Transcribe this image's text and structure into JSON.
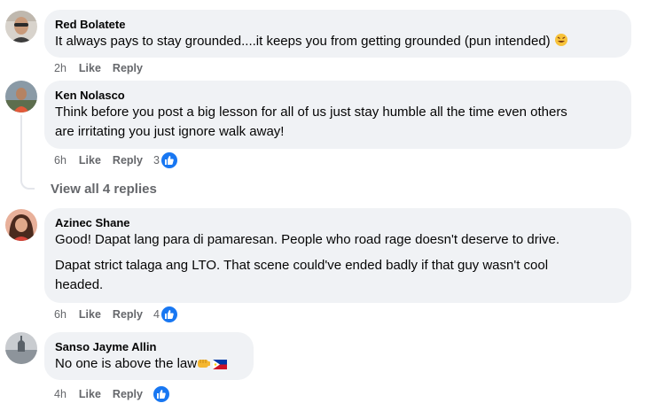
{
  "comments": [
    {
      "author": "Red Bolatete",
      "text": "It always pays to stay grounded....it keeps you from getting grounded (pun intended)",
      "time": "2h",
      "like": "Like",
      "reply": "Reply"
    },
    {
      "author": "Ken Nolasco",
      "text1": "Think before you post a big lesson for all of us just stay humble all the time even others",
      "text2": "are irritating you just ignore walk away!",
      "time": "6h",
      "like": "Like",
      "reply": "Reply",
      "reactions": "3",
      "view_replies": "View all 4 replies"
    },
    {
      "author": "Azinec Shane",
      "text1": "Good! Dapat lang para di pamaresan. People who road rage doesn't deserve to drive.",
      "text2": "Dapat strict talaga ang LTO. That scene could've ended badly if that guy wasn't cool",
      "text3": "headed.",
      "time": "6h",
      "like": "Like",
      "reply": "Reply",
      "reactions": "4"
    },
    {
      "author": "Sanso Jayme Allin",
      "text": "No one is above the law",
      "time": "4h",
      "like": "Like",
      "reply": "Reply"
    }
  ],
  "icons": {
    "reaction": "like-thumb-icon",
    "emoji_laugh": "rolling-laughing-emoji-icon",
    "emoji_fist": "oncoming-fist-emoji-icon",
    "flag": "philippines-flag-icon"
  },
  "colors": {
    "bubble": "#f0f2f5",
    "meta": "#65676b",
    "like_blue": "#1877f2"
  }
}
